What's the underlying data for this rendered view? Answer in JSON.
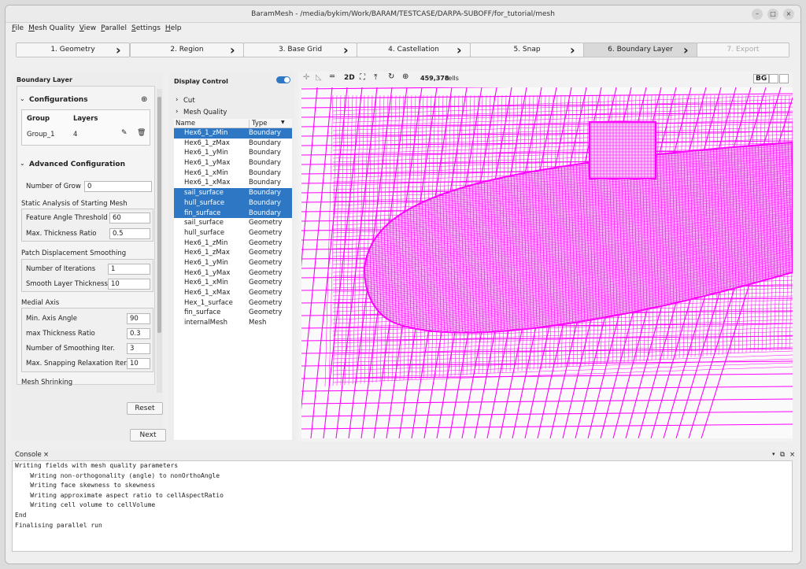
{
  "window": {
    "title": "BaramMesh - /media/bykim/Work/BARAM/TESTCASE/DARPA-SUBOFF/for_tutorial/mesh"
  },
  "menu": [
    "File",
    "Mesh Quality",
    "View",
    "Parallel",
    "Settings",
    "Help"
  ],
  "steps": [
    "1. Geometry",
    "2. Region",
    "3. Base Grid",
    "4. Castellation",
    "5. Snap",
    "6. Boundary Layer",
    "7. Export"
  ],
  "left": {
    "title": "Boundary Layer",
    "configurations": "Configurations",
    "table_headers": [
      "Group",
      "Layers"
    ],
    "table_row": {
      "group": "Group_1",
      "layers": "4"
    },
    "advanced": "Advanced Configuration",
    "number_of_grow_label": "Number of Grow",
    "number_of_grow": "0",
    "static_analysis": "Static Analysis of Starting Mesh",
    "feature_angle_label": "Feature Angle Threshold",
    "feature_angle": "60",
    "max_thickness_label": "Max. Thickness Ratio",
    "max_thickness": "0.5",
    "patch_displacement": "Patch Displacement Smoothing",
    "iterations_label": "Number of Iterations",
    "iterations": "1",
    "smooth_layer_label": "Smooth Layer Thickness",
    "smooth_layer": "10",
    "medial_axis": "Medial Axis",
    "min_axis_angle_label": "Min. Axis Angle",
    "min_axis_angle": "90",
    "max_thick_ratio_label": "max Thickness Ratio",
    "max_thick_ratio": "0.3",
    "smoothing_iter_label": "Number of Smoothing Iter.",
    "smoothing_iter": "3",
    "snap_relax_label": "Max. Snapping Relaxation Iter.",
    "snap_relax": "10",
    "mesh_shrinking": "Mesh Shrinking",
    "reset": "Reset",
    "next": "Next"
  },
  "display": {
    "title": "Display Control",
    "cut": "Cut",
    "mesh_quality": "Mesh Quality",
    "col_name": "Name",
    "col_type": "Type",
    "rows": [
      {
        "name": "Hex6_1_zMin",
        "type": "Boundary",
        "sel": true
      },
      {
        "name": "Hex6_1_zMax",
        "type": "Boundary",
        "sel": false
      },
      {
        "name": "Hex6_1_yMin",
        "type": "Boundary",
        "sel": false
      },
      {
        "name": "Hex6_1_yMax",
        "type": "Boundary",
        "sel": false
      },
      {
        "name": "Hex6_1_xMin",
        "type": "Boundary",
        "sel": false
      },
      {
        "name": "Hex6_1_xMax",
        "type": "Boundary",
        "sel": false
      },
      {
        "name": "sail_surface",
        "type": "Boundary",
        "sel": true
      },
      {
        "name": "hull_surface",
        "type": "Boundary",
        "sel": true
      },
      {
        "name": "fin_surface",
        "type": "Boundary",
        "sel": true
      },
      {
        "name": "sail_surface",
        "type": "Geometry",
        "sel": false
      },
      {
        "name": "hull_surface",
        "type": "Geometry",
        "sel": false
      },
      {
        "name": "Hex6_1_zMin",
        "type": "Geometry",
        "sel": false
      },
      {
        "name": "Hex6_1_zMax",
        "type": "Geometry",
        "sel": false
      },
      {
        "name": "Hex6_1_yMin",
        "type": "Geometry",
        "sel": false
      },
      {
        "name": "Hex6_1_yMax",
        "type": "Geometry",
        "sel": false
      },
      {
        "name": "Hex6_1_xMin",
        "type": "Geometry",
        "sel": false
      },
      {
        "name": "Hex6_1_xMax",
        "type": "Geometry",
        "sel": false
      },
      {
        "name": "Hex_1_surface",
        "type": "Geometry",
        "sel": false
      },
      {
        "name": "fin_surface",
        "type": "Geometry",
        "sel": false
      },
      {
        "name": "internalMesh",
        "type": "Mesh",
        "sel": false
      }
    ]
  },
  "viewport": {
    "mode_2d": "2D",
    "cells_count": "459,378",
    "cells_label": "cells",
    "bg": "BG",
    "mesh_color": "#ff00ff"
  },
  "console": {
    "tab": "Console",
    "lines": [
      "Writing fields with mesh quality parameters",
      "    Writing non-orthogonality (angle) to nonOrthoAngle",
      "    Writing face skewness to skewness",
      "    Writing approximate aspect ratio to cellAspectRatio",
      "    Writing cell volume to cellVolume",
      "End",
      "Finalising parallel run"
    ]
  }
}
